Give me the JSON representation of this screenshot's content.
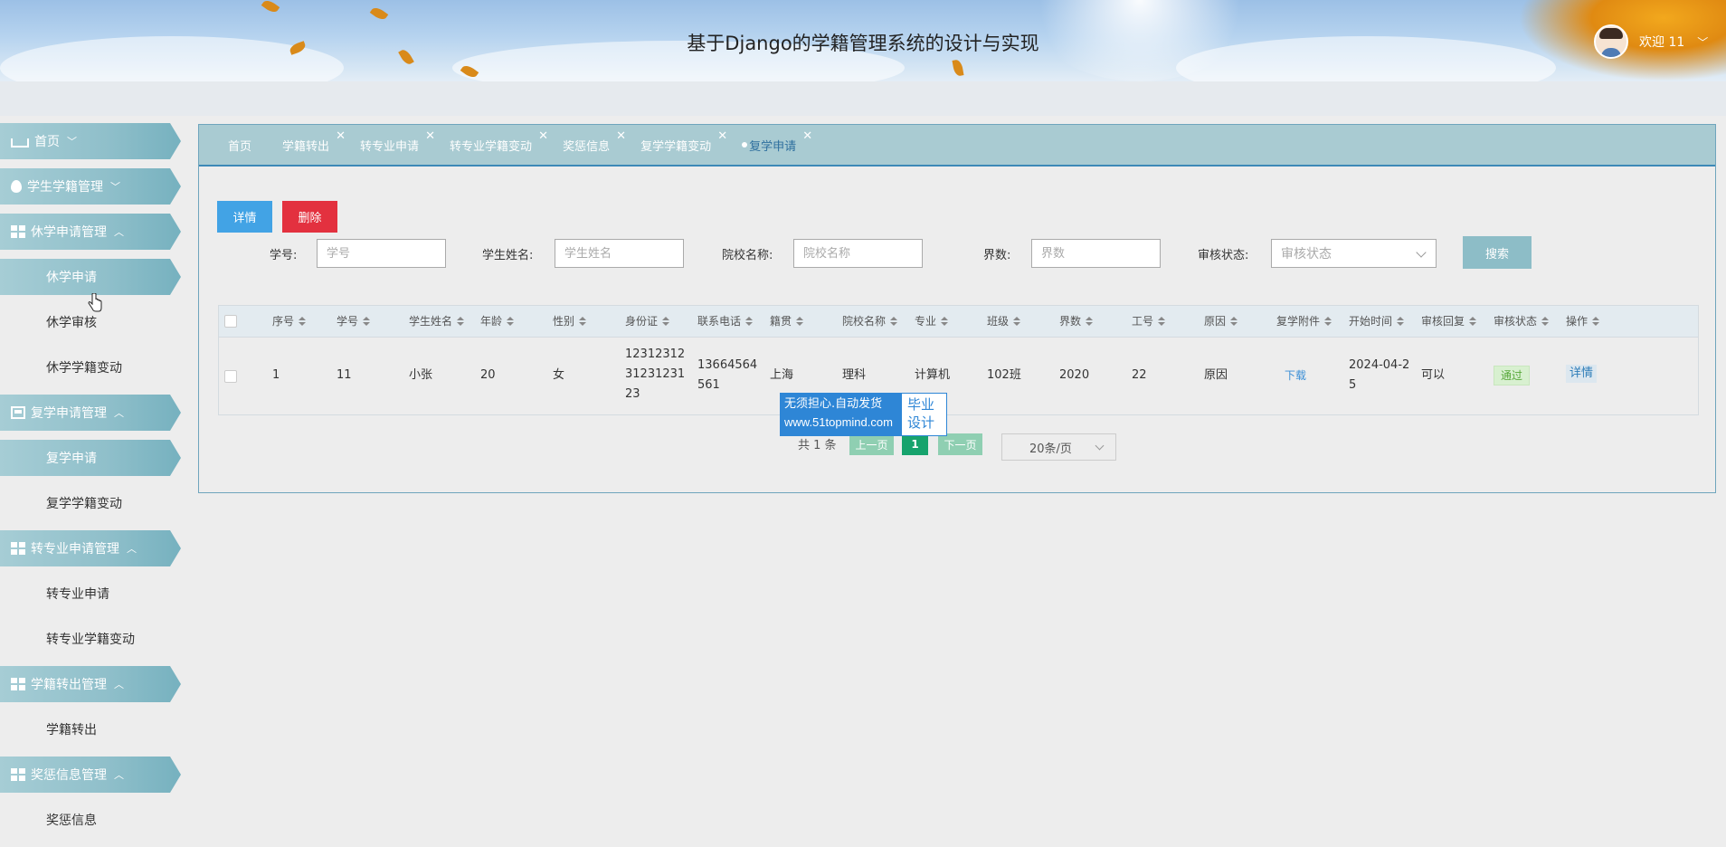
{
  "header": {
    "title": "基于Django的学籍管理系统的设计与实现",
    "welcome": "欢迎 11"
  },
  "sidebar": {
    "groups": [
      {
        "label": "首页",
        "icon": "home-icon",
        "items": []
      },
      {
        "label": "学生学籍管理",
        "icon": "drop-icon",
        "items": []
      },
      {
        "label": "休学申请管理",
        "icon": "grid-icon",
        "items": [
          "休学申请",
          "休学审核",
          "休学学籍变动"
        ]
      },
      {
        "label": "复学申请管理",
        "icon": "image-icon",
        "items": [
          "复学申请",
          "复学学籍变动"
        ]
      },
      {
        "label": "转专业申请管理",
        "icon": "grid-icon",
        "items": [
          "转专业申请",
          "转专业学籍变动"
        ]
      },
      {
        "label": "学籍转出管理",
        "icon": "layout-icon",
        "items": [
          "学籍转出"
        ]
      },
      {
        "label": "奖惩信息管理",
        "icon": "layout-icon",
        "items": [
          "奖惩信息"
        ]
      }
    ]
  },
  "tabs": [
    "首页",
    "学籍转出",
    "转专业申请",
    "转专业学籍变动",
    "奖惩信息",
    "复学学籍变动",
    "复学申请"
  ],
  "toolbar": {
    "detail": "详情",
    "delete": "删除"
  },
  "filters": {
    "student_id": {
      "label": "学号:",
      "placeholder": "学号"
    },
    "student_name": {
      "label": "学生姓名:",
      "placeholder": "学生姓名"
    },
    "school": {
      "label": "院校名称:",
      "placeholder": "院校名称"
    },
    "term": {
      "label": "界数:",
      "placeholder": "界数"
    },
    "status": {
      "label": "审核状态:",
      "placeholder": "审核状态"
    },
    "search": "搜索"
  },
  "table": {
    "columns": [
      "序号",
      "学号",
      "学生姓名",
      "年龄",
      "性别",
      "身份证",
      "联系电话",
      "籍贯",
      "院校名称",
      "专业",
      "班级",
      "界数",
      "工号",
      "原因",
      "复学附件",
      "开始时间",
      "审核回复",
      "审核状态",
      "操作"
    ],
    "rows": [
      {
        "index": "1",
        "student_id": "11",
        "name": "小张",
        "age": "20",
        "gender": "女",
        "id_card": [
          "12312312",
          "31231231",
          "23"
        ],
        "phone": [
          "13664564",
          "561"
        ],
        "native": "上海",
        "school": "理科",
        "major": "计算机",
        "class": "102班",
        "term": "2020",
        "work_id": "22",
        "reason": "原因",
        "attachment": "下载",
        "start_time": [
          "2024-04-2",
          "5"
        ],
        "reply": "可以",
        "status": "通过",
        "action": "详情"
      }
    ]
  },
  "pagination": {
    "total": "共 1 条",
    "prev": "上一页",
    "current": "1",
    "next": "下一页",
    "page_size": "20条/页"
  },
  "watermark": {
    "line1": "无须担心.自动发货",
    "line2": "www.51topmind.com",
    "right1": "毕业",
    "right2": "设计"
  }
}
